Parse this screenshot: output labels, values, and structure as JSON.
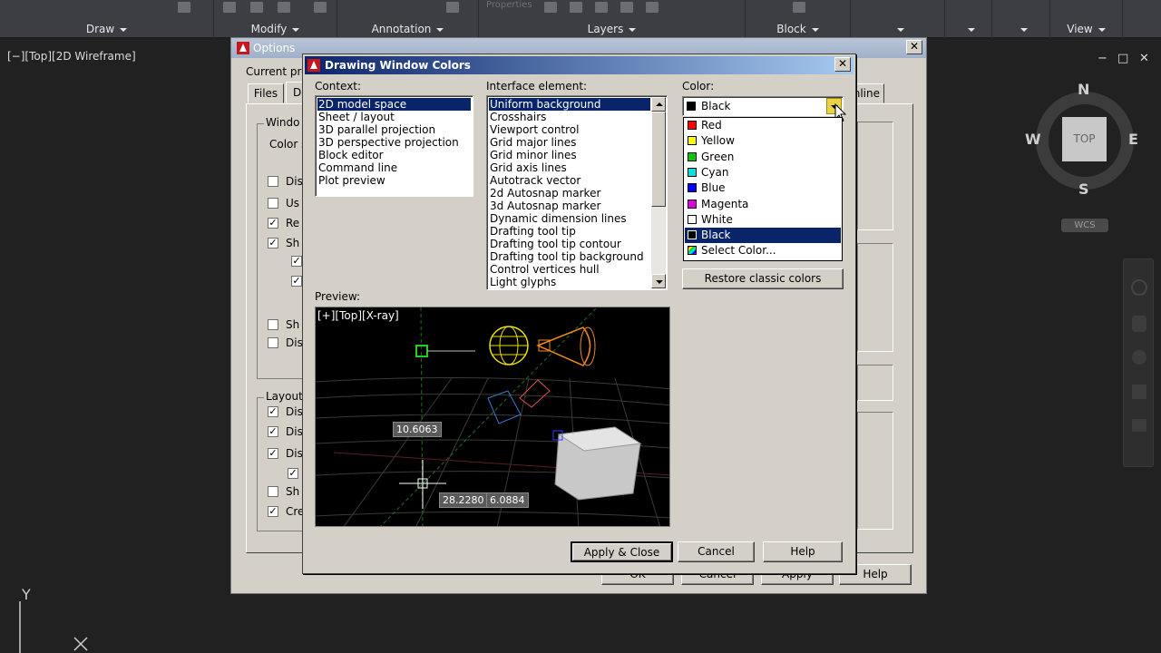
{
  "ribbon": {
    "panels": [
      {
        "label": "Draw"
      },
      {
        "label": "Modify"
      },
      {
        "label": "Annotation"
      },
      {
        "label": "Layers"
      },
      {
        "label": "Block"
      },
      {
        "label": "View"
      }
    ],
    "properties_label": "Properties"
  },
  "viewport": {
    "label": "[−][Top][2D Wireframe]",
    "controls": [
      "−",
      "□",
      "✕"
    ],
    "viewcube": {
      "n": "N",
      "s": "S",
      "e": "E",
      "w": "W",
      "face": "TOP",
      "wcs": "WCS"
    },
    "ucs_y": "Y"
  },
  "options_dialog": {
    "title": "Options",
    "current_profile_label": "Current profi",
    "tabs": [
      "Files",
      "D",
      "nline"
    ],
    "window_group_label": "Windo",
    "color_scheme_label": "Color s",
    "window_checks": [
      {
        "label": "Dis",
        "checked": false
      },
      {
        "label": "Us",
        "checked": false
      },
      {
        "label": "Re",
        "checked": true
      },
      {
        "label": "Sh",
        "checked": true
      },
      {
        "label": "",
        "checked": true
      },
      {
        "label": "",
        "checked": true
      },
      {
        "label": "Sh",
        "checked": false
      },
      {
        "label": "Dis",
        "checked": false
      }
    ],
    "layout_group_label": "Layout",
    "layout_checks": [
      {
        "label": "Dis",
        "checked": true
      },
      {
        "label": "Dis",
        "checked": true
      },
      {
        "label": "Dis",
        "checked": true
      },
      {
        "label": "",
        "checked": true
      },
      {
        "label": "Sh",
        "checked": false
      },
      {
        "label": "Cre",
        "checked": true
      }
    ],
    "buttons": {
      "ok": "OK",
      "cancel": "Cancel",
      "apply": "Apply",
      "help": "Help"
    }
  },
  "dwc": {
    "title": "Drawing Window Colors",
    "context_label": "Context:",
    "context_items": [
      "2D model space",
      "Sheet / layout",
      "3D parallel projection",
      "3D perspective projection",
      "Block editor",
      "Command line",
      "Plot preview"
    ],
    "context_selected": 0,
    "interface_label": "Interface element:",
    "interface_items": [
      "Uniform background",
      "Crosshairs",
      "Viewport control",
      "Grid major lines",
      "Grid minor lines",
      "Grid axis lines",
      "Autotrack vector",
      "2d Autosnap marker",
      "3d Autosnap marker",
      "Dynamic dimension lines",
      "Drafting tool tip",
      "Drafting tool tip contour",
      "Drafting tool tip background",
      "Control vertices hull",
      "Light glyphs"
    ],
    "interface_selected": 0,
    "color_label": "Color:",
    "color_value": "Black",
    "color_options": [
      {
        "name": "Red",
        "hex": "#ff0000"
      },
      {
        "name": "Yellow",
        "hex": "#ffff00"
      },
      {
        "name": "Green",
        "hex": "#00cc00"
      },
      {
        "name": "Cyan",
        "hex": "#00e0e0"
      },
      {
        "name": "Blue",
        "hex": "#0000ff"
      },
      {
        "name": "Magenta",
        "hex": "#e000e0"
      },
      {
        "name": "White",
        "hex": "#ffffff"
      },
      {
        "name": "Black",
        "hex": "#000000"
      },
      {
        "name": "Select Color...",
        "hex": "multicolor"
      }
    ],
    "color_selected": 7,
    "restore_label": "Restore classic colors",
    "preview_label": "Preview:",
    "preview_view_label": "[+][Top][X-ray]",
    "preview_dims": [
      "10.6063",
      "28.2280",
      "6.0884"
    ],
    "buttons": {
      "apply_close": "Apply & Close",
      "cancel": "Cancel",
      "help": "Help"
    }
  }
}
